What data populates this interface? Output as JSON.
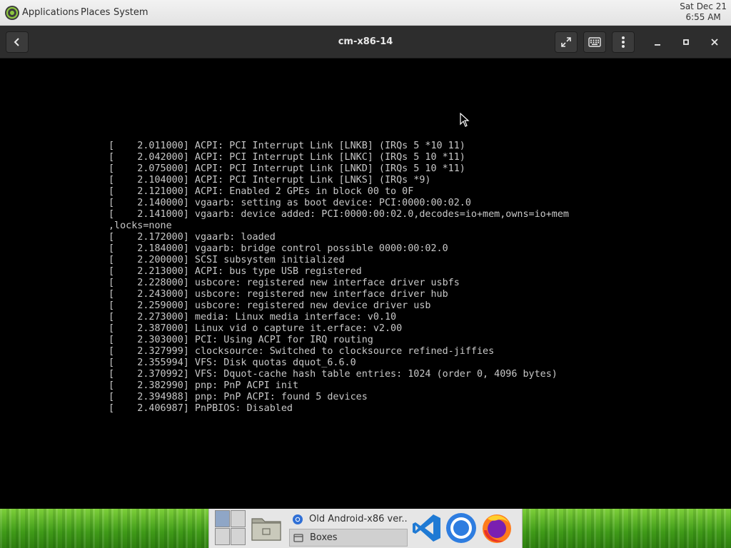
{
  "top_panel": {
    "menus": [
      "Applications",
      "Places",
      "System"
    ],
    "clock": {
      "date": "Sat Dec 21",
      "time": "6:55 AM"
    }
  },
  "window": {
    "title": "cm-x86-14"
  },
  "console": {
    "lines": [
      "[    2.011000] ACPI: PCI Interrupt Link [LNKB] (IRQs 5 *10 11)",
      "[    2.042000] ACPI: PCI Interrupt Link [LNKC] (IRQs 5 10 *11)",
      "[    2.075000] ACPI: PCI Interrupt Link [LNKD] (IRQs 5 10 *11)",
      "[    2.104000] ACPI: PCI Interrupt Link [LNKS] (IRQs *9)",
      "[    2.121000] ACPI: Enabled 2 GPEs in block 00 to 0F",
      "[    2.140000] vgaarb: setting as boot device: PCI:0000:00:02.0",
      "[    2.141000] vgaarb: device added: PCI:0000:00:02.0,decodes=io+mem,owns=io+mem",
      ",locks=none",
      "[    2.172000] vgaarb: loaded",
      "[    2.184000] vgaarb: bridge control possible 0000:00:02.0",
      "[    2.200000] SCSI subsystem initialized",
      "[    2.213000] ACPI: bus type USB registered",
      "[    2.228000] usbcore: registered new interface driver usbfs",
      "[    2.243000] usbcore: registered new interface driver hub",
      "[    2.259000] usbcore: registered new device driver usb",
      "[    2.273000] media: Linux media interface: v0.10",
      "[    2.387000] Linux vid o capture it.erface: v2.00",
      "[    2.303000] PCI: Using ACPI for IRQ routing",
      "[    2.327999] clocksource: Switched to clocksource refined-jiffies",
      "[    2.355994] VFS: Disk quotas dquot_6.6.0",
      "[    2.370992] VFS: Dquot-cache hash table entries: 1024 (order 0, 4096 bytes)",
      "[    2.382990] pnp: PnP ACPI init",
      "[    2.394988] pnp: PnP ACPI: found 5 devices",
      "[    2.406987] PnPBIOS: Disabled"
    ]
  },
  "taskbar": {
    "tasks": [
      {
        "label": "Old Android-x86 ver...",
        "icon": "chrome-icon",
        "active": false
      },
      {
        "label": "Boxes",
        "icon": "boxes-icon",
        "active": true
      }
    ],
    "launchers": [
      "vscode-icon",
      "chromium-icon",
      "firefox-icon"
    ]
  },
  "colors": {
    "console_bg": "#000000",
    "console_text": "#c8c8c8",
    "header_bg": "#2d2d2d",
    "panel_bg": "#ececec"
  }
}
